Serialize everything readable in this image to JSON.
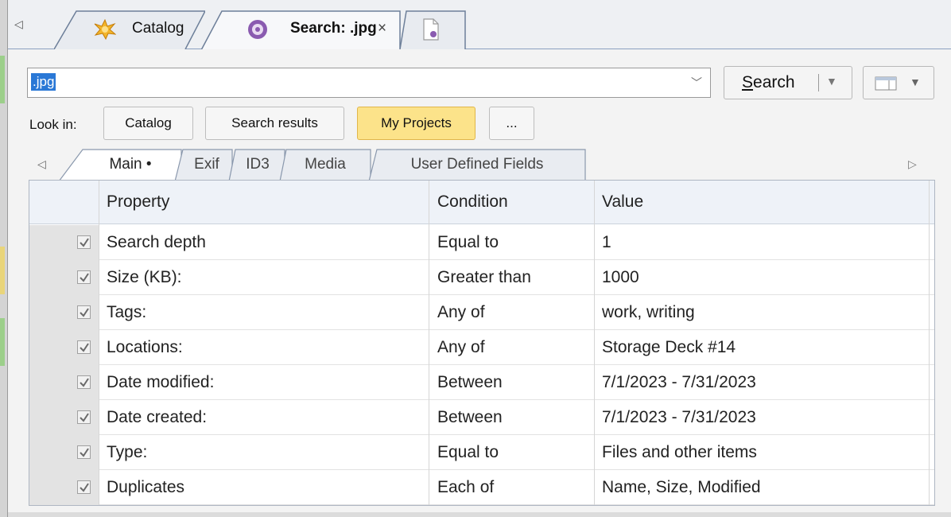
{
  "doc_tabs": [
    {
      "label": "Catalog",
      "icon": "catalog-burst-icon"
    },
    {
      "label": "Search: .jpg",
      "icon": "search-orb-icon",
      "close": "×"
    },
    {
      "label": "",
      "icon": "new-document-icon"
    }
  ],
  "search": {
    "query": ".jpg",
    "button_label_prefix": "S",
    "button_label_rest": "earch"
  },
  "look_in": {
    "label": "Look in:",
    "options": [
      "Catalog",
      "Search results",
      "My Projects",
      "..."
    ],
    "active": "My Projects"
  },
  "criteria_tabs": [
    "Main •",
    "Exif",
    "ID3",
    "Media",
    "User Defined Fields"
  ],
  "grid": {
    "columns": [
      "Property",
      "Condition",
      "Value"
    ],
    "rows": [
      {
        "checked": true,
        "property": "Search depth",
        "condition": "Equal to",
        "value": "1"
      },
      {
        "checked": true,
        "property": "Size (KB):",
        "condition": "Greater than",
        "value": "1000"
      },
      {
        "checked": true,
        "property": "Tags:",
        "condition": "Any of",
        "value": "work, writing"
      },
      {
        "checked": true,
        "property": "Locations:",
        "condition": "Any of",
        "value": "Storage Deck #14"
      },
      {
        "checked": true,
        "property": "Date modified:",
        "condition": "Between",
        "value": "7/1/2023 - 7/31/2023"
      },
      {
        "checked": true,
        "property": "Date created:",
        "condition": "Between",
        "value": "7/1/2023 - 7/31/2023"
      },
      {
        "checked": true,
        "property": "Type:",
        "condition": "Equal to",
        "value": "Files and other items"
      },
      {
        "checked": true,
        "property": "Duplicates",
        "condition": "Each of",
        "value": "Name, Size, Modified"
      }
    ]
  },
  "colors": {
    "selection": "#2a78d6",
    "active_lookin": "#fce38a",
    "grid_header": "#eef2f8"
  }
}
